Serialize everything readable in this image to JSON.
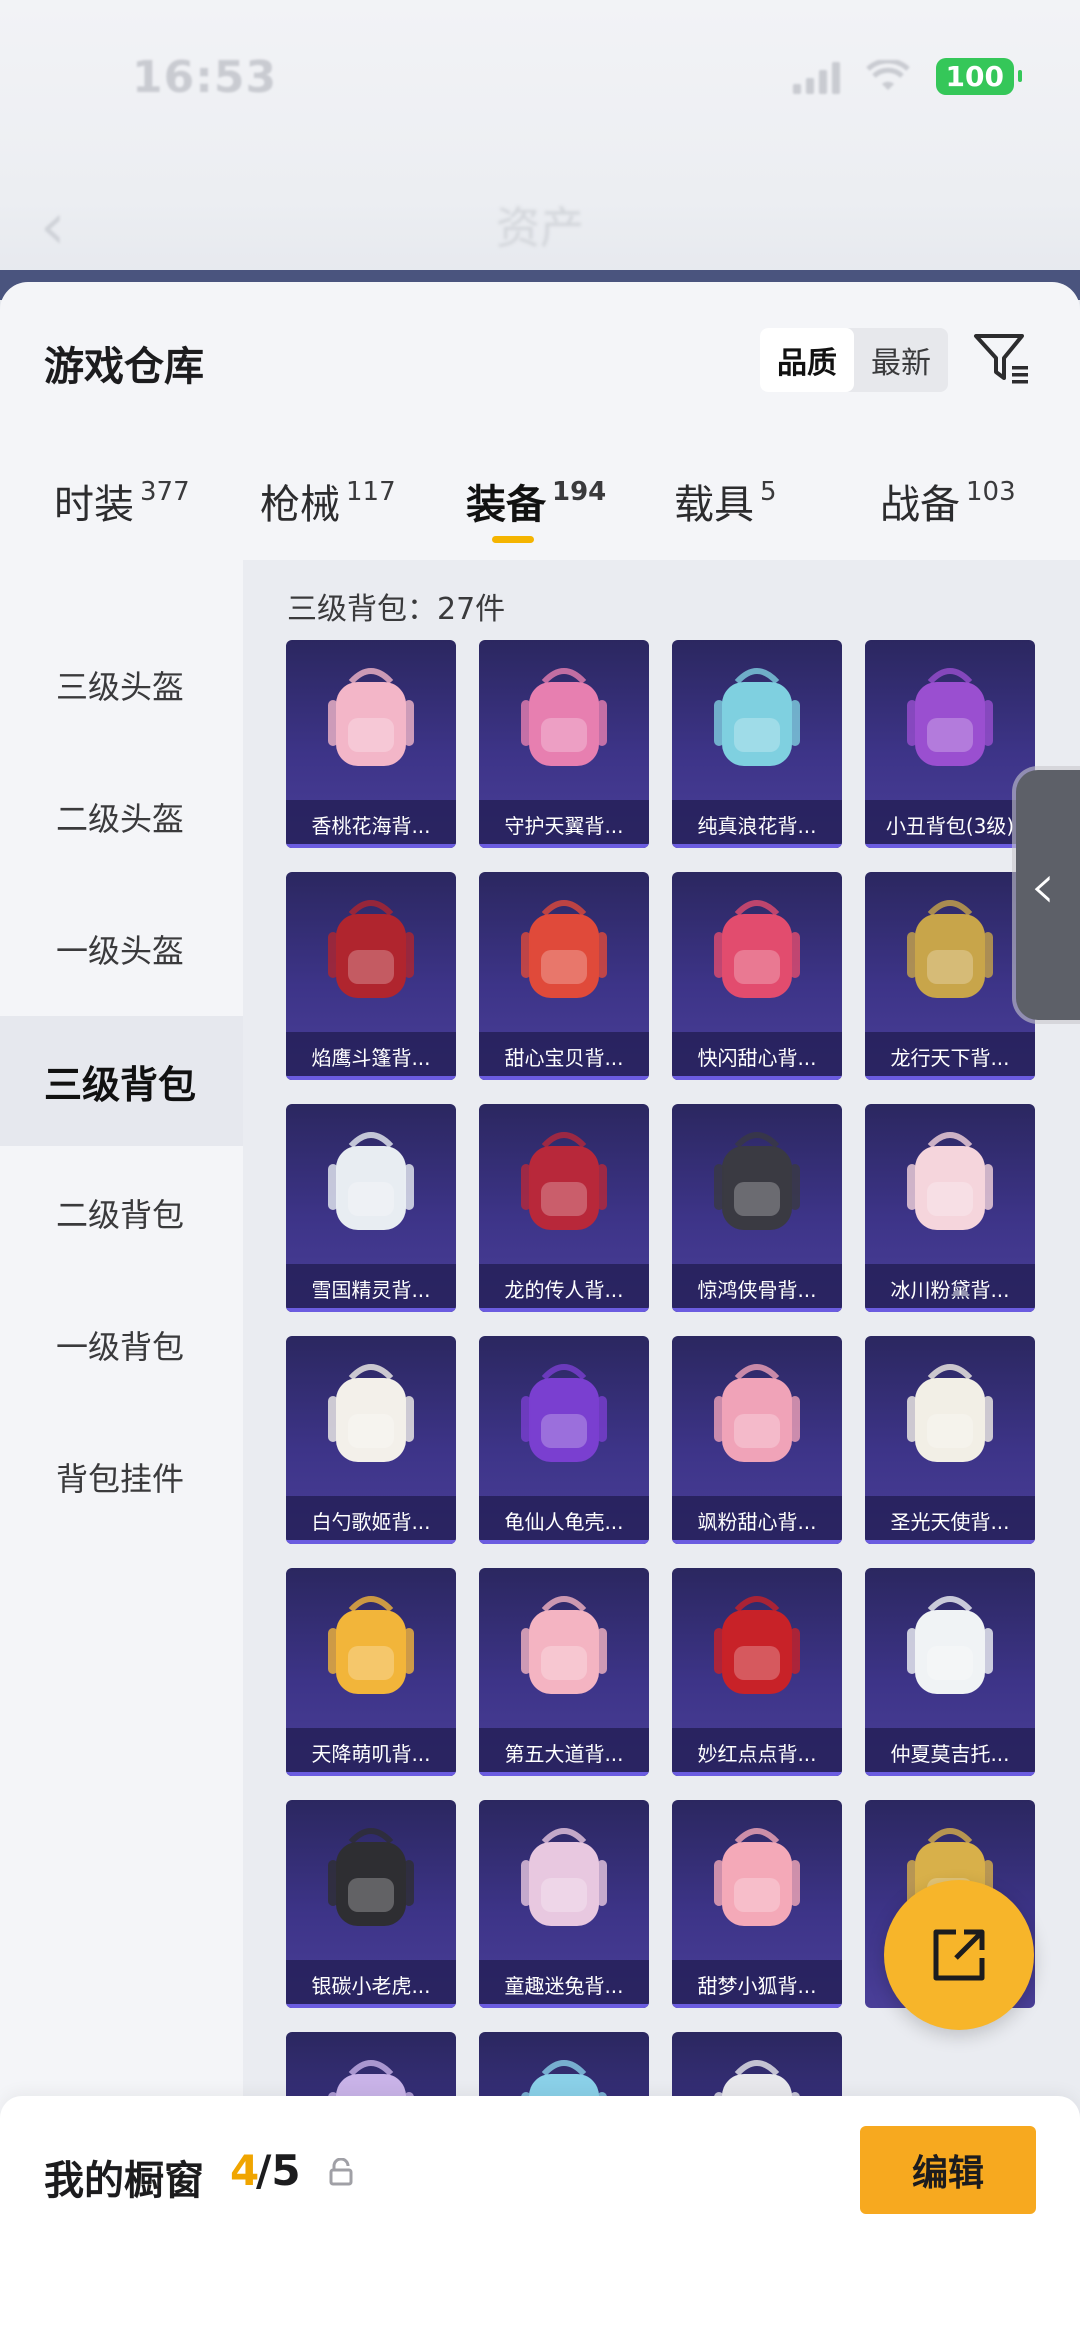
{
  "status_bar": {
    "time": "16:53",
    "battery": "100"
  },
  "background_header": {
    "title": "资产"
  },
  "sheet": {
    "title": "游戏仓库",
    "sort": {
      "options": [
        "品质",
        "最新"
      ],
      "selected": "品质"
    }
  },
  "tabs": [
    {
      "label": "时装",
      "count": "377"
    },
    {
      "label": "枪械",
      "count": "117"
    },
    {
      "label": "装备",
      "count": "194",
      "active": true
    },
    {
      "label": "载具",
      "count": "5"
    },
    {
      "label": "战备",
      "count": "103"
    }
  ],
  "categories": [
    {
      "label": "三级头盔"
    },
    {
      "label": "二级头盔"
    },
    {
      "label": "一级头盔"
    },
    {
      "label": "三级背包",
      "active": true
    },
    {
      "label": "二级背包"
    },
    {
      "label": "一级背包"
    },
    {
      "label": "背包挂件"
    }
  ],
  "grid": {
    "count_label": "三级背包：27件",
    "items": [
      {
        "name": "香桃花海背...",
        "color": "#f3b6c8"
      },
      {
        "name": "守护天翼背...",
        "color": "#e77fb0"
      },
      {
        "name": "纯真浪花背...",
        "color": "#7fd0e0"
      },
      {
        "name": "小丑背包(3级)",
        "color": "#9a4fd0"
      },
      {
        "name": "焰鹰斗篷背...",
        "color": "#b0252e"
      },
      {
        "name": "甜心宝贝背...",
        "color": "#e04a3a"
      },
      {
        "name": "快闪甜心背...",
        "color": "#e24c6e"
      },
      {
        "name": "龙行天下背...",
        "color": "#c8a54a"
      },
      {
        "name": "雪国精灵背...",
        "color": "#e8edf2"
      },
      {
        "name": "龙的传人背...",
        "color": "#b8283a"
      },
      {
        "name": "惊鸿侠骨背...",
        "color": "#3a3a42"
      },
      {
        "name": "冰川粉黛背...",
        "color": "#f5d5dc"
      },
      {
        "name": "白勺歌姬背...",
        "color": "#f3f0ea"
      },
      {
        "name": "龟仙人龟壳...",
        "color": "#7a3fd0"
      },
      {
        "name": "飒粉甜心背...",
        "color": "#f0a3b8"
      },
      {
        "name": "圣光天使背...",
        "color": "#f2efe6"
      },
      {
        "name": "天降萌叽背...",
        "color": "#f2b53a"
      },
      {
        "name": "第五大道背...",
        "color": "#f4b4c2"
      },
      {
        "name": "妙红点点背...",
        "color": "#c82228"
      },
      {
        "name": "仲夏莫吉托...",
        "color": "#f0f3f5"
      },
      {
        "name": "银碳小老虎...",
        "color": "#2e2e32"
      },
      {
        "name": "童趣迷兔背...",
        "color": "#e8c8e0"
      },
      {
        "name": "甜梦小狐背...",
        "color": "#f4a9b8"
      },
      {
        "name": "",
        "color": "#d8b04a"
      },
      {
        "name": "",
        "color": "#c9b3e8"
      },
      {
        "name": "",
        "color": "#8ad0e8"
      },
      {
        "name": "",
        "color": "#e8e8ec"
      }
    ]
  },
  "showcase": {
    "label": "我的橱窗",
    "current": "4",
    "total": "/5",
    "edit_label": "编辑"
  },
  "colors": {
    "accent": "#f7a91f",
    "tab_underline": "#f4b400",
    "card_bg": "#3d3488"
  }
}
